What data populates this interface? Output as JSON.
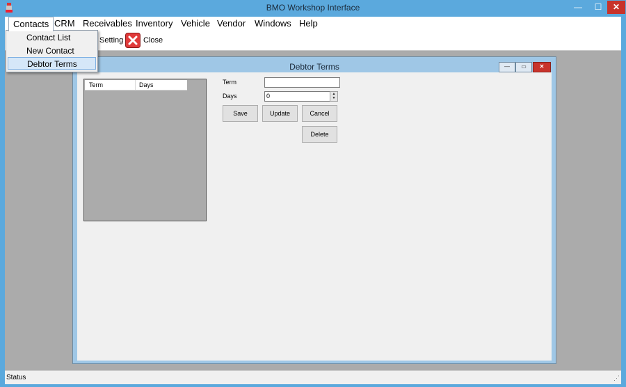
{
  "window": {
    "title": "BMO Workshop Interface",
    "minimize": "—",
    "maximize": "☐",
    "close": "✕"
  },
  "menu": {
    "items": [
      "Contacts",
      "CRM",
      "Receivables",
      "Inventory",
      "Vehicle",
      "Vendor",
      "Windows",
      "Help"
    ],
    "open": "Contacts",
    "dropdown": [
      "Contact List",
      "New Contact",
      "Debtor Terms"
    ],
    "highlighted": "Debtor Terms"
  },
  "toolbar": {
    "setting_label": "Setting",
    "close_label": "Close"
  },
  "status": {
    "text": "Status"
  },
  "child": {
    "title": "Debtor Terms",
    "minimize": "—",
    "maximize": "▭",
    "close": "✕",
    "grid": {
      "columns": [
        "Term",
        "Days"
      ]
    },
    "form": {
      "term_label": "Term",
      "days_label": "Days",
      "term_value": "",
      "days_value": "0",
      "save": "Save",
      "update": "Update",
      "cancel": "Cancel",
      "delete": "Delete"
    }
  },
  "colors": {
    "title_bar": "#5ba9dd",
    "mdi_background": "#ababab",
    "close_red": "#c8332b",
    "highlight": "#d5e7f8"
  }
}
